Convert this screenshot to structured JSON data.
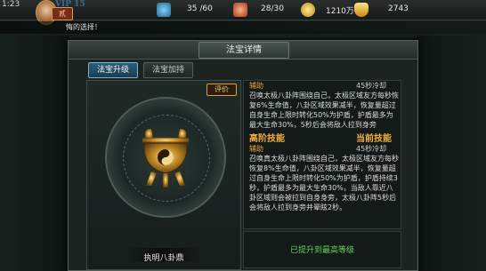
{
  "status_bar": {
    "time": "1:23",
    "vip": "VIP 15",
    "player_level": "贰",
    "stamina": "35 /60",
    "energy": "28/30",
    "coins": "1210万",
    "gold": "2743",
    "stamina_icon": "stamina-icon",
    "energy_icon": "energy-icon",
    "coin_icon": "coin-icon",
    "gold_icon": "gold-ingot-icon",
    "cornflower": "#3a6b8f"
  },
  "notice": {
    "text": "悔的选择！"
  },
  "dialog": {
    "title": "法宝详情",
    "tabs": [
      {
        "label": "法宝升级",
        "active": true
      },
      {
        "label": "法宝加持",
        "active": false
      }
    ]
  },
  "left_panel": {
    "evaluate_label": "评价",
    "item_name": "执明八卦鼎",
    "item_icon": "bronze-cauldron-icon"
  },
  "right_panel": {
    "skill1": {
      "type": "辅助",
      "cooldown": "45秒冷却",
      "description": "召唤太极八卦阵围绕自己，太极区域友方每秒恢复6%生命值，八卦区域效果减半，恢复量超过自身生命上限时转化50%为护盾，护盾最多为最大生命30%，5秒后会将敌人拉到身旁"
    },
    "section_title": "高阶技能",
    "current_label": "当前技能",
    "skill2": {
      "type": "辅助",
      "cooldown": "45秒冷却",
      "description": "召唤真太极八卦阵围绕自己，太极区域友方每秒恢复8%生命值，八卦区域效果减半，恢复量超过自身生命上限时转化50%为护盾，护盾持续3秒，护盾最多为最大生命30%，当敌人靠近八卦区域则会被拉到自身身旁，太极八卦阵5秒后会将敌人拉到身旁并晕眩2秒。"
    },
    "maxed_text": "已提升到最高等级"
  },
  "colors": {
    "accent_gold": "#f0b040",
    "skill_type_orange": "#e8a040",
    "success_green": "#5fd35f",
    "tab_active": "#6fb4d8"
  }
}
